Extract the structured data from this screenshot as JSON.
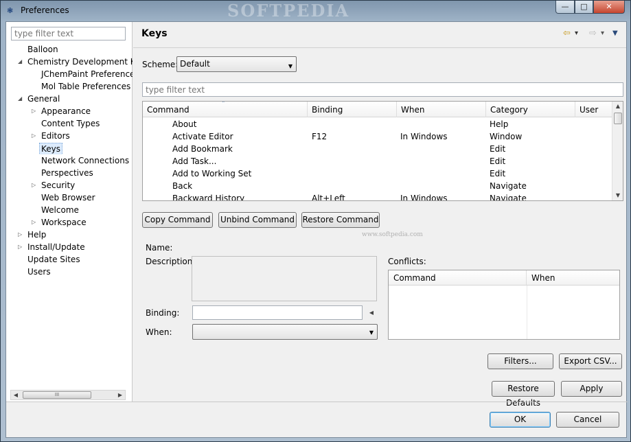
{
  "window": {
    "title": "Preferences",
    "watermark": "SOFTPEDIA",
    "controls": {
      "minimize": "—",
      "maximize": "□",
      "close": "✕"
    }
  },
  "sidebar": {
    "filter_placeholder": "type filter text",
    "items": [
      {
        "label": "Balloon",
        "indent": 0,
        "arrow": ""
      },
      {
        "label": "Chemistry Development Kit",
        "indent": 0,
        "arrow": "◢"
      },
      {
        "label": "JChemPaint Preference",
        "indent": 1,
        "arrow": ""
      },
      {
        "label": "Mol Table Preferences",
        "indent": 1,
        "arrow": ""
      },
      {
        "label": "General",
        "indent": 0,
        "arrow": "◢"
      },
      {
        "label": "Appearance",
        "indent": 1,
        "arrow": "▷"
      },
      {
        "label": "Content Types",
        "indent": 1,
        "arrow": ""
      },
      {
        "label": "Editors",
        "indent": 1,
        "arrow": "▷"
      },
      {
        "label": "Keys",
        "indent": 1,
        "arrow": "",
        "selected": true
      },
      {
        "label": "Network Connections",
        "indent": 1,
        "arrow": ""
      },
      {
        "label": "Perspectives",
        "indent": 1,
        "arrow": ""
      },
      {
        "label": "Security",
        "indent": 1,
        "arrow": "▷"
      },
      {
        "label": "Web Browser",
        "indent": 1,
        "arrow": ""
      },
      {
        "label": "Welcome",
        "indent": 1,
        "arrow": ""
      },
      {
        "label": "Workspace",
        "indent": 1,
        "arrow": "▷"
      },
      {
        "label": "Help",
        "indent": 0,
        "arrow": "▷"
      },
      {
        "label": "Install/Update",
        "indent": 0,
        "arrow": "▷"
      },
      {
        "label": "Update Sites",
        "indent": 0,
        "arrow": ""
      },
      {
        "label": "Users",
        "indent": 0,
        "arrow": ""
      }
    ],
    "scroll_grip": "III"
  },
  "page": {
    "title": "Keys",
    "nav": {
      "back": "⇦",
      "back_menu": "▾",
      "forward": "⇨",
      "forward_menu": "▾",
      "view_menu": "▼"
    }
  },
  "scheme": {
    "label": "Scheme:",
    "value": "Default"
  },
  "filter_placeholder": "type filter text",
  "commands": {
    "headers": [
      "Command",
      "Binding",
      "When",
      "Category",
      "User"
    ],
    "rows": [
      [
        "About",
        "",
        "",
        "Help",
        ""
      ],
      [
        "Activate Editor",
        "F12",
        "In Windows",
        "Window",
        ""
      ],
      [
        "Add Bookmark",
        "",
        "",
        "Edit",
        ""
      ],
      [
        "Add Task...",
        "",
        "",
        "Edit",
        ""
      ],
      [
        "Add to Working Set",
        "",
        "",
        "Edit",
        ""
      ],
      [
        "Back",
        "",
        "",
        "Navigate",
        ""
      ],
      [
        "Backward History",
        "Alt+Left",
        "In Windows",
        "Navigate",
        ""
      ]
    ]
  },
  "buttons": {
    "copy": "Copy Command",
    "unbind": "Unbind Command",
    "restore_command": "Restore Command",
    "filters": "Filters...",
    "export_csv": "Export CSV...",
    "restore_defaults": "Restore Defaults",
    "apply": "Apply",
    "ok": "OK",
    "cancel": "Cancel"
  },
  "details": {
    "name_label": "Name:",
    "description_label": "Description:",
    "binding_label": "Binding:",
    "when_label": "When:",
    "binding_value": "",
    "when_value": ""
  },
  "conflicts": {
    "label": "Conflicts:",
    "headers": [
      "Command",
      "When"
    ]
  },
  "watermark_small": "www.softpedia.com"
}
